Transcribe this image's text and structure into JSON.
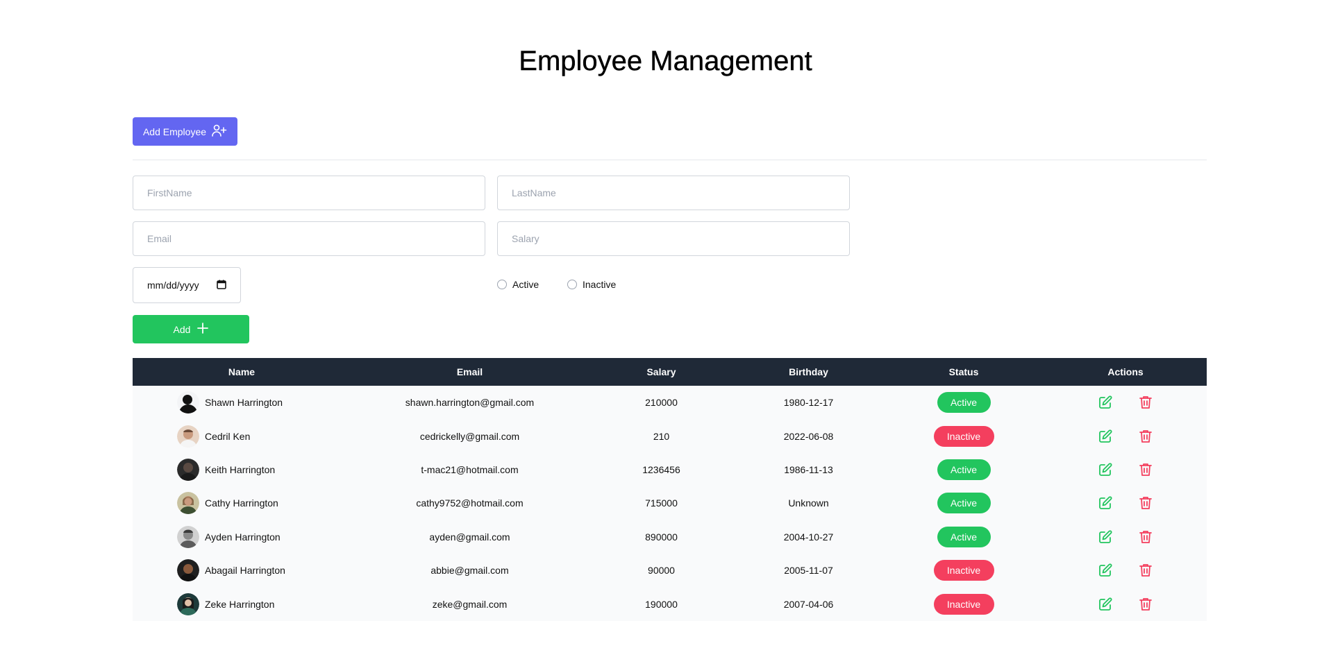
{
  "page": {
    "title": "Employee Management"
  },
  "toolbar": {
    "add_employee_label": "Add Employee",
    "add_employee_icon": "user-plus-icon"
  },
  "form": {
    "firstname_placeholder": "FirstName",
    "lastname_placeholder": "LastName",
    "email_placeholder": "Email",
    "salary_placeholder": "Salary",
    "date_placeholder": "mm/dd/yyyy",
    "date_icon": "calendar-icon",
    "status_options": [
      "Active",
      "Inactive"
    ],
    "add_label": "Add",
    "add_icon": "plus-icon"
  },
  "table": {
    "columns": [
      "Name",
      "Email",
      "Salary",
      "Birthday",
      "Status",
      "Actions"
    ],
    "rows": [
      {
        "name": "Shawn Harrington",
        "email": "shawn.harrington@gmail.com",
        "salary": "210000",
        "birthday": "1980-12-17",
        "status": "Active"
      },
      {
        "name": "Cedril Ken",
        "email": "cedrickelly@gmail.com",
        "salary": "210",
        "birthday": "2022-06-08",
        "status": "Inactive"
      },
      {
        "name": "Keith Harrington",
        "email": "t-mac21@hotmail.com",
        "salary": "1236456",
        "birthday": "1986-11-13",
        "status": "Active"
      },
      {
        "name": "Cathy Harrington",
        "email": "cathy9752@hotmail.com",
        "salary": "715000",
        "birthday": "Unknown",
        "status": "Active"
      },
      {
        "name": "Ayden Harrington",
        "email": "ayden@gmail.com",
        "salary": "890000",
        "birthday": "2004-10-27",
        "status": "Active"
      },
      {
        "name": "Abagail Harrington",
        "email": "abbie@gmail.com",
        "salary": "90000",
        "birthday": "2005-11-07",
        "status": "Inactive"
      },
      {
        "name": "Zeke Harrington",
        "email": "zeke@gmail.com",
        "salary": "190000",
        "birthday": "2007-04-06",
        "status": "Inactive"
      }
    ]
  },
  "colors": {
    "primary": "#6366f1",
    "success": "#22c55e",
    "danger": "#f43f5e",
    "header_bg": "#1f2937",
    "row_bg": "#f9fafb"
  }
}
